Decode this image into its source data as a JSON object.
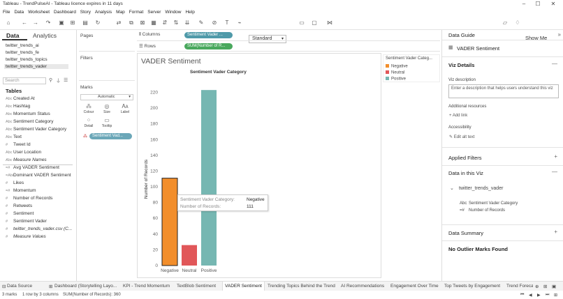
{
  "window": {
    "title": "Tableau - TrendPulseAI - Tableau licence expires in 11 days"
  },
  "menu": [
    "File",
    "Data",
    "Worksheet",
    "Dashboard",
    "Story",
    "Analysis",
    "Map",
    "Format",
    "Server",
    "Window",
    "Help"
  ],
  "toolbar": {
    "fit_value": "Standard",
    "show_me": "Show Me"
  },
  "left_pane": {
    "tabs": {
      "data": "Data",
      "analytics": "Analytics"
    },
    "datasources": [
      "twitter_trends_ai",
      "twitter_trends_fe",
      "twitter_trends_topics",
      "twitter_trends_vader"
    ],
    "search_placeholder": "Search",
    "tables_heading": "Tables",
    "dimensions": [
      {
        "icon": "Abc",
        "label": "Created At"
      },
      {
        "icon": "Abc",
        "label": "Hashtag"
      },
      {
        "icon": "Abc",
        "label": "Momentum Status"
      },
      {
        "icon": "Abc",
        "label": "Sentiment Category"
      },
      {
        "icon": "Abc",
        "label": "Sentiment Vader Category"
      },
      {
        "icon": "Abc",
        "label": "Text"
      },
      {
        "icon": "#",
        "label": "Tweet Id"
      },
      {
        "icon": "Abc",
        "label": "User Location"
      },
      {
        "icon": "Abc",
        "label": "Measure Names"
      }
    ],
    "measures": [
      {
        "icon": "=#",
        "label": "Avg VADER Sentiment"
      },
      {
        "icon": "=Abc",
        "label": "Dominant VADER Sentiment"
      },
      {
        "icon": "#",
        "label": "Likes"
      },
      {
        "icon": "=#",
        "label": "Momentum"
      },
      {
        "icon": "#",
        "label": "Number of Records"
      },
      {
        "icon": "#",
        "label": "Retweets"
      },
      {
        "icon": "#",
        "label": "Sentiment"
      },
      {
        "icon": "#",
        "label": "Sentiment Vader"
      },
      {
        "icon": "#",
        "label": "twitter_trends_vader.csv (C..."
      },
      {
        "icon": "#",
        "label": "Measure Values"
      }
    ]
  },
  "cards": {
    "pages": "Pages",
    "filters": "Filters",
    "marks": "Marks",
    "mark_type": "Automatic",
    "buttons": {
      "colour": "Colour",
      "size": "Size",
      "label": "Label",
      "detail": "Detail",
      "tooltip": "Tooltip"
    },
    "mark_pill": "Sentiment Vad..."
  },
  "shelves": {
    "columns_label": "Columns",
    "rows_label": "Rows",
    "columns_pill": "Sentiment Vader ...",
    "rows_pill": "SUM(Number of R..."
  },
  "view": {
    "title": "VADER Sentiment"
  },
  "chart_data": {
    "type": "bar",
    "title": "Sentiment Vader Category",
    "xlabel": "",
    "ylabel": "Number of Records",
    "categories": [
      "Negative",
      "Neutral",
      "Positive"
    ],
    "values": [
      111,
      26,
      223
    ],
    "colors": [
      "#f28e2b",
      "#e15759",
      "#76b7b2"
    ],
    "yticks": [
      0,
      20,
      40,
      60,
      80,
      100,
      120,
      140,
      160,
      180,
      200,
      220
    ],
    "ylim": [
      0,
      232
    ],
    "grid": false,
    "highlighted": "Negative"
  },
  "legend": {
    "title": "Sentiment Vader Categ...",
    "items": [
      {
        "label": "Negative",
        "color": "#f28e2b"
      },
      {
        "label": "Neutral",
        "color": "#e15759"
      },
      {
        "label": "Positive",
        "color": "#76b7b2"
      }
    ]
  },
  "tooltip": {
    "line1_label": "Sentiment Vader Category:",
    "line1_value": "Negative",
    "line2_label": "Number of Records:",
    "line2_value": "111"
  },
  "data_guide": {
    "title": "Data Guide",
    "sheet": "VADER Sentiment",
    "viz_details": "Viz Details",
    "viz_description_label": "Viz description",
    "viz_description_placeholder": "Enter a description that helps users understand this viz",
    "additional_resources": "Additional resources",
    "add_link": "Add link",
    "accessibility": "Accessibility",
    "edit_alt_text": "Edit alt text",
    "applied_filters": "Applied Filters",
    "data_in_viz": "Data in this Viz",
    "source": "twitter_trends_vader",
    "fields": [
      "Sentiment Vader Category",
      "Number of Records"
    ],
    "data_summary": "Data Summary",
    "no_outliers": "No Outlier Marks Found"
  },
  "sheet_tabs": [
    "Data Source",
    "Dashboard (Storytelling Layo...",
    "KPI - Trend Momentum",
    "TextBlob Sentiment",
    "VADER Sentiment",
    "Trending Topics Behind the Trend",
    "AI Recommendations",
    "Engagement Over Time",
    "Top Tweets by Engagement",
    "Trend Forecas"
  ],
  "active_tab": "VADER Sentiment",
  "status": {
    "marks": "3 marks",
    "rowscols": "1 row by 3 columns",
    "sum": "SUM(Number of Records): 360"
  }
}
